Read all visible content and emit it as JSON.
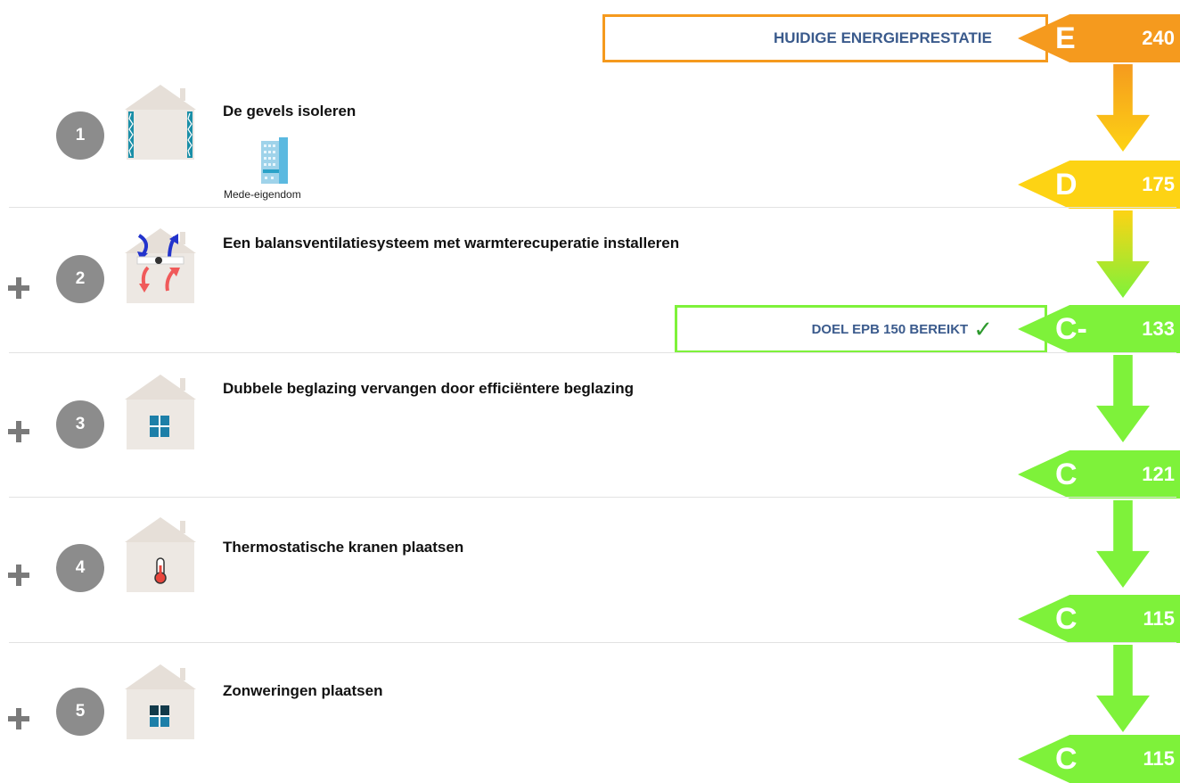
{
  "header": {
    "current_label": "HUIDIGE ENERGIEPRESTATIE",
    "target_label": "DOEL EPB 150 BEREIKT",
    "target_check": "✓"
  },
  "labels": [
    {
      "class": "E",
      "value": "240",
      "color": "#f59a1e"
    },
    {
      "class": "D",
      "value": "175",
      "color": "#fdd314"
    },
    {
      "class": "C-",
      "value": "133",
      "color": "#7ef23a"
    },
    {
      "class": "C",
      "value": "121",
      "color": "#7ef23a"
    },
    {
      "class": "C",
      "value": "115",
      "color": "#7ef23a"
    },
    {
      "class": "C",
      "value": "115",
      "color": "#7ef23a"
    }
  ],
  "measures": [
    {
      "number": "1",
      "title": "De gevels isoleren",
      "sub_label": "Mede-eigendom",
      "icon": "insulated-walls-house-icon"
    },
    {
      "number": "2",
      "title": "Een balansventilatiesysteem met warmterecuperatie installeren",
      "icon": "ventilation-house-icon"
    },
    {
      "number": "3",
      "title": "Dubbele beglazing vervangen door efficiëntere beglazing",
      "icon": "window-house-icon"
    },
    {
      "number": "4",
      "title": "Thermostatische kranen plaatsen",
      "icon": "thermostat-house-icon"
    },
    {
      "number": "5",
      "title": "Zonweringen plaatsen",
      "icon": "sunshade-house-icon"
    }
  ],
  "colors": {
    "orange": "#f59a1e",
    "yellow": "#fdd314",
    "green": "#7ef23a",
    "text_blue": "#3a5a8c"
  }
}
